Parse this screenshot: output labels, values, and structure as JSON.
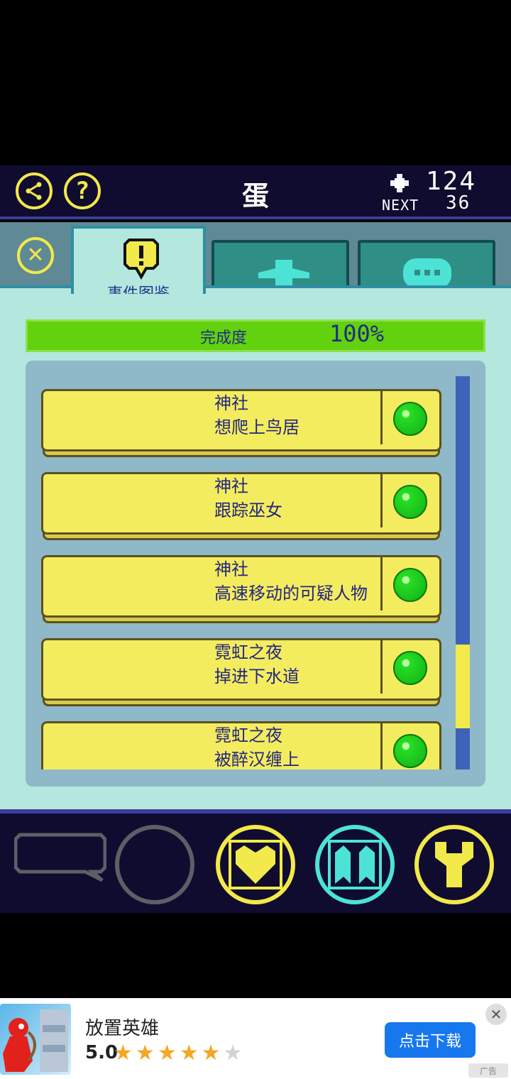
{
  "header": {
    "title": "蛋",
    "count": "124",
    "next_label": "NEXT",
    "next_value": "36"
  },
  "tabs": [
    {
      "label": "事件图鉴",
      "icon": "exclamation-balloon-icon",
      "active": true
    },
    {
      "label": "",
      "icon": "character-silhouette-icon",
      "active": false
    },
    {
      "label": "",
      "icon": "speech-dots-icon",
      "active": false
    }
  ],
  "progress": {
    "label": "完成度",
    "value_text": "100%",
    "fraction": 1.0
  },
  "events": [
    {
      "category": "神社",
      "name": "想爬上鸟居",
      "completed": true
    },
    {
      "category": "神社",
      "name": "跟踪巫女",
      "completed": true
    },
    {
      "category": "神社",
      "name": "高速移动的可疑人物",
      "completed": true
    },
    {
      "category": "霓虹之夜",
      "name": "掉进下水道",
      "completed": true
    },
    {
      "category": "霓虹之夜",
      "name": "被醉汉缠上",
      "completed": true
    }
  ],
  "bottom_nav": [
    {
      "icon": "speech-bubble-icon",
      "state": "disabled"
    },
    {
      "icon": "empty-circle-icon",
      "state": "disabled"
    },
    {
      "icon": "heart-icon",
      "state": "enabled"
    },
    {
      "icon": "ghost-icon",
      "state": "active"
    },
    {
      "icon": "wrench-icon",
      "state": "enabled"
    }
  ],
  "ad": {
    "title": "放置英雄",
    "rating": "5.0",
    "stars_filled": 5,
    "stars_total": 6,
    "button_label": "点击下载",
    "tag": "广告"
  },
  "colors": {
    "accent_yellow": "#f2e94a",
    "panel_mint": "#b4e7dd",
    "progress_green": "#62d10e",
    "header_navy": "#100c30",
    "text_navy": "#22267f",
    "cyan_active": "#4ce3d6"
  }
}
